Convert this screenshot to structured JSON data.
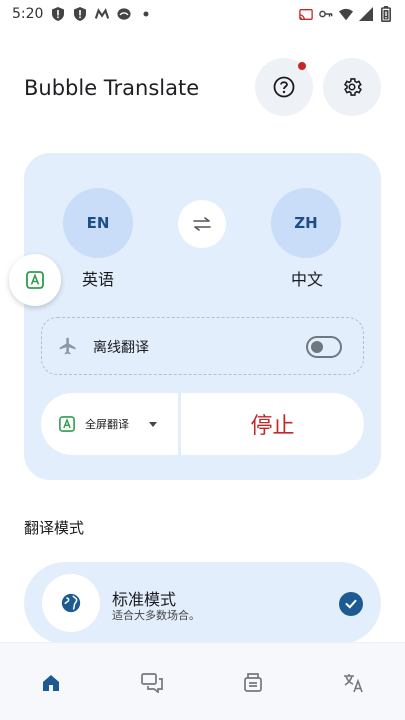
{
  "status_bar": {
    "time": "5:20",
    "left_icons": [
      "shield-alert-icon",
      "shield-alert-icon",
      "m-logo-icon",
      "speaker-icon",
      "dot-icon"
    ],
    "right_icons": [
      "cast-icon",
      "key-icon",
      "wifi-icon",
      "signal-icon",
      "battery-icon"
    ]
  },
  "header": {
    "title": "Bubble Translate",
    "help_icon": "help-icon",
    "settings_icon": "gear-icon",
    "notification_color": "#c62828"
  },
  "language_card": {
    "source": {
      "code": "EN",
      "name": "英语"
    },
    "target": {
      "code": "ZH",
      "name": "中文"
    },
    "swap_icon": "swap-icon",
    "offline": {
      "label": "离线翻译",
      "icon": "airplane-icon",
      "enabled": false
    },
    "mode_select": {
      "label": "全屏翻译",
      "icon": "translate-a-icon"
    },
    "stop_label": "停止"
  },
  "floating_bubble": {
    "icon": "translate-a-icon"
  },
  "translation_mode": {
    "section_title": "翻译模式",
    "selected": {
      "name": "标准模式",
      "desc": "适合大多数场合。",
      "icon": "globe-icon",
      "checked": true
    }
  },
  "bottom_nav": {
    "items": [
      {
        "icon": "home-icon",
        "active": true
      },
      {
        "icon": "chat-icon",
        "active": false
      },
      {
        "icon": "document-icon",
        "active": false
      },
      {
        "icon": "translate-icon",
        "active": false
      }
    ]
  },
  "colors": {
    "accent": "#1d5a91",
    "card_bg": "#e3eefc",
    "lang_circle": "#c9ddf8",
    "stop_text": "#c62828",
    "green_icon": "#2e9d4c"
  }
}
